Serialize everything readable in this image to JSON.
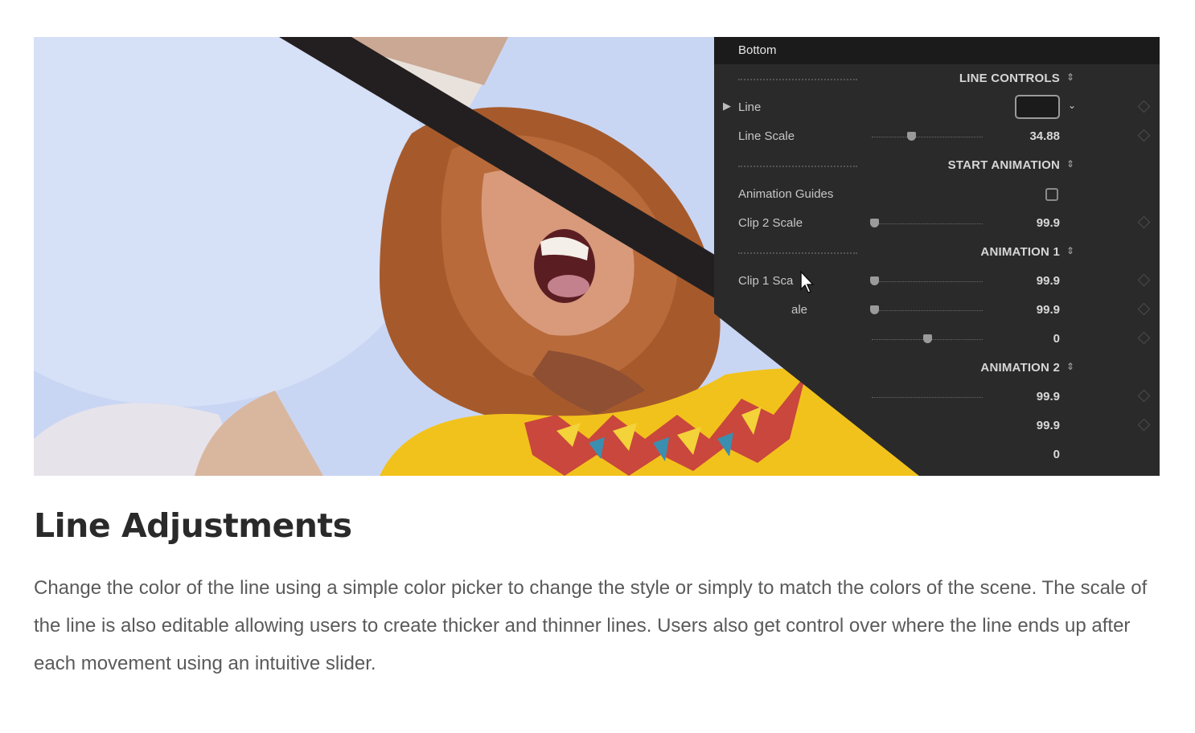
{
  "panel": {
    "header": "Bottom",
    "sections": {
      "line_controls": "LINE CONTROLS",
      "start_animation": "START ANIMATION",
      "animation1": "ANIMATION 1",
      "animation2": "ANIMATION 2"
    },
    "updown_glyph": "⇕",
    "expand_glyph": "▶",
    "caret_glyph": "⌄",
    "rows": {
      "line": {
        "label": "Line"
      },
      "line_scale": {
        "label": "Line Scale",
        "value": "34.88"
      },
      "animation_guides": {
        "label": "Animation Guides"
      },
      "clip2_scale": {
        "label": "Clip 2 Scale",
        "value": "99.9"
      },
      "clip1_scale": {
        "label": "Clip 1 Sca",
        "value": "99.9"
      },
      "row_a": {
        "label": "ale",
        "value": "99.9"
      },
      "row_b": {
        "value": "0"
      },
      "row_c": {
        "value": "99.9"
      },
      "row_d": {
        "value": "99.9"
      },
      "row_e": {
        "value": "0"
      }
    }
  },
  "article": {
    "title": "Line Adjustments",
    "body": "Change the color of the line using a simple color picker to change the style or simply to match the colors of the scene. The scale of the line is also editable allowing users to create thicker and thinner lines. Users also get control over where the line ends up after each movement using an intuitive slider."
  },
  "colors": {
    "sky": "#c9d6f3",
    "panel_bg": "#2a2a2a",
    "divider_line": "#231f20",
    "dress": "#f2c21c",
    "hair": "#a65a2c"
  }
}
